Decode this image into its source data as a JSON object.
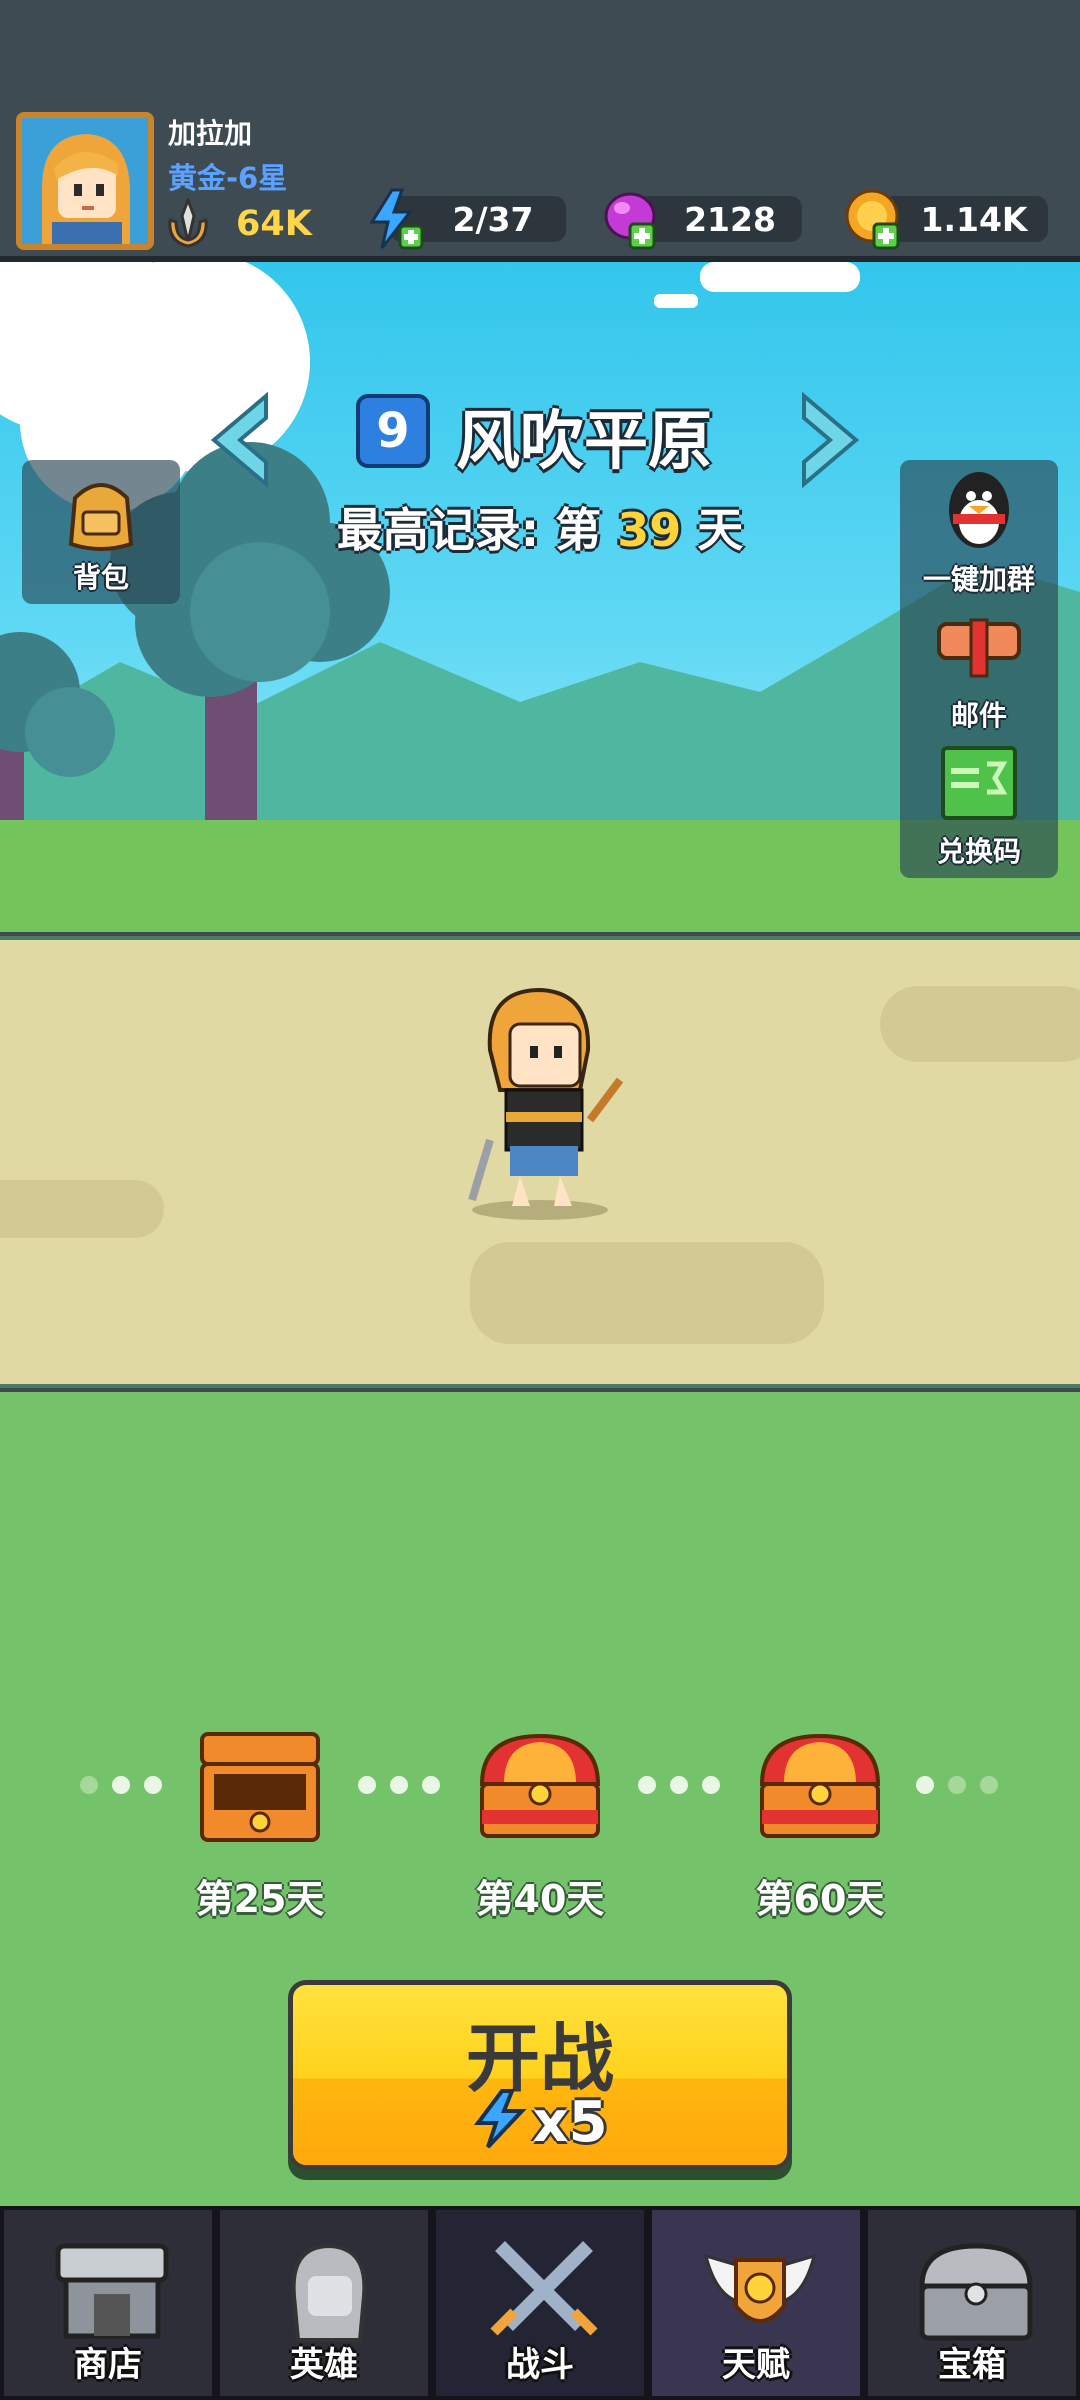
{
  "player": {
    "name": "加拉加",
    "rank": "黄金-6星",
    "power": "64K",
    "avatar": "hero-portrait"
  },
  "resources": {
    "energy": {
      "value": "2/37",
      "icon": "energy-plus-icon"
    },
    "gems": {
      "value": "2128",
      "icon": "gem-plus-icon"
    },
    "gold": {
      "value": "1.14K",
      "icon": "gold-plus-icon"
    }
  },
  "stage": {
    "number": "9",
    "name": "风吹平原",
    "record_prefix": "最高记录: 第",
    "record_days": "39",
    "record_suffix": "天"
  },
  "side_buttons": {
    "bag": "背包",
    "group": "一键加群",
    "mail": "邮件",
    "redeem": "兑换码"
  },
  "rewards": [
    {
      "label": "第25天",
      "state": "opened"
    },
    {
      "label": "第40天",
      "state": "closed"
    },
    {
      "label": "第60天",
      "state": "closed"
    }
  ],
  "start_button": {
    "title": "开战",
    "cost": "x5"
  },
  "bottom_nav": [
    {
      "label": "商店",
      "icon": "shop-icon"
    },
    {
      "label": "英雄",
      "icon": "hero-icon"
    },
    {
      "label": "战斗",
      "icon": "crossed-swords-icon"
    },
    {
      "label": "天赋",
      "icon": "talent-wings-icon"
    },
    {
      "label": "宝箱",
      "icon": "treasure-chest-icon"
    }
  ],
  "colors": {
    "accent": "#ffd21c",
    "record_highlight": "#ffd43b",
    "rank_blue": "#5aa2ff",
    "lawn": "#74c36b"
  }
}
